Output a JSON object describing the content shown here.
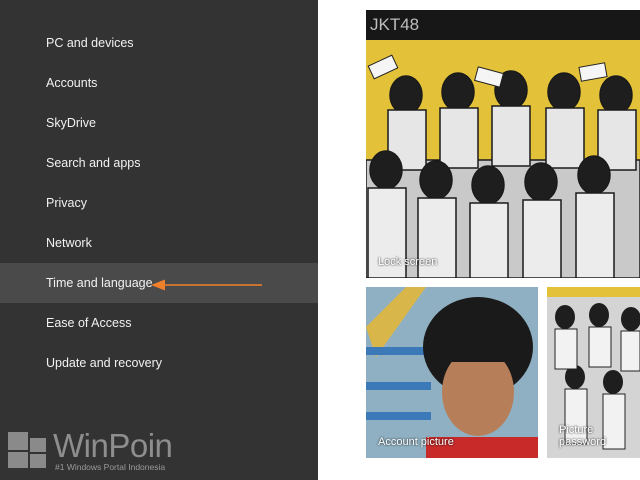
{
  "sidebar": {
    "items": [
      {
        "label": "PC and devices"
      },
      {
        "label": "Accounts"
      },
      {
        "label": "SkyDrive"
      },
      {
        "label": "Search and apps"
      },
      {
        "label": "Privacy"
      },
      {
        "label": "Network"
      },
      {
        "label": "Time and language",
        "selected": true
      },
      {
        "label": "Ease of Access"
      },
      {
        "label": "Update and recovery"
      }
    ]
  },
  "watermark": {
    "brand": "WinPoin",
    "tagline": "#1 Windows Portal Indonesia"
  },
  "content": {
    "group_title": "JKT48",
    "tiles": {
      "lock_screen": "Lock screen",
      "account_picture": "Account picture",
      "picture_password": "Picture password"
    }
  },
  "colors": {
    "sidebar_bg": "#333333",
    "selected_bg": "#4a4a4a",
    "arrow": "#f07f2a",
    "tile_accent": "#e8c83a"
  }
}
